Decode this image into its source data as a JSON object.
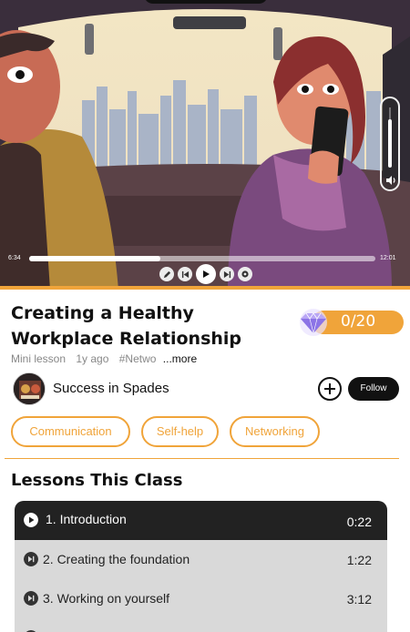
{
  "player": {
    "current_time": "6:34",
    "duration": "12:01",
    "progress": 0.38,
    "volume": 0.8,
    "controls": [
      "pencil-icon",
      "skip-back-icon",
      "play-icon",
      "skip-forward-icon",
      "settings-icon"
    ]
  },
  "lesson": {
    "title_line1": "Creating a Healthy",
    "title_line2": "Workplace Relationship",
    "type": "Mini lesson",
    "age": "1y ago",
    "hashtag": "#Netwo",
    "more_label": "...more",
    "score": "0/20"
  },
  "channel": {
    "name": "Success in Spades",
    "follow_label": "Follow"
  },
  "tags": [
    "Communication",
    "Self-help",
    "Networking"
  ],
  "section_title": "Lessons This Class",
  "lessons": [
    {
      "label": "1. Introduction",
      "duration": "0:22",
      "active": true
    },
    {
      "label": "2. Creating the foundation",
      "duration": "1:22",
      "active": false
    },
    {
      "label": "3. Working on yourself",
      "duration": "3:12",
      "active": false
    }
  ],
  "colors": {
    "accent": "#f0a43a",
    "dark": "#111111",
    "lesson_bg": "#d9d9d9"
  }
}
